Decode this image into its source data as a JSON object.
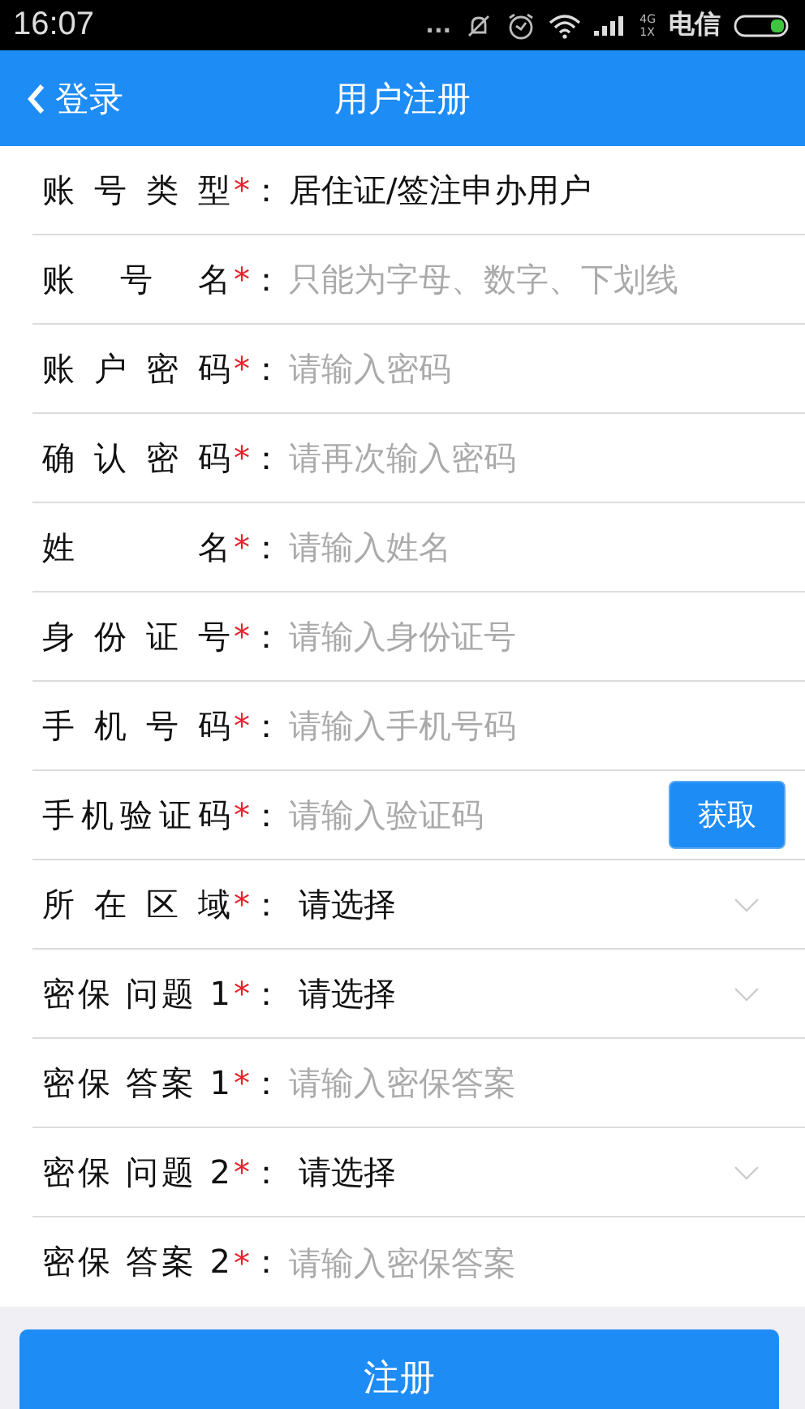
{
  "status_bar": {
    "time": "16:07",
    "dots": "...",
    "network": "4G",
    "network_sub": "1X",
    "carrier": "电信"
  },
  "header": {
    "back": "登录",
    "title": "用户注册"
  },
  "fields": [
    {
      "kind": "value",
      "label": "账 号 类 型",
      "asterisk": "*",
      "colon": "：",
      "value": "居住证/签注申办用户"
    },
    {
      "kind": "input",
      "label": "账 号 名",
      "asterisk": "*",
      "colon": "：",
      "placeholder": "只能为字母、数字、下划线"
    },
    {
      "kind": "input",
      "label": "账 户 密 码",
      "asterisk": "*",
      "colon": "：",
      "placeholder": "请输入密码"
    },
    {
      "kind": "input",
      "label": "确 认 密 码",
      "asterisk": "*",
      "colon": "：",
      "placeholder": "请再次输入密码"
    },
    {
      "kind": "input",
      "label": "姓 名",
      "asterisk": "*",
      "colon": "：",
      "placeholder": "请输入姓名"
    },
    {
      "kind": "input",
      "label": "身 份 证 号",
      "asterisk": "*",
      "colon": "：",
      "placeholder": "请输入身份证号"
    },
    {
      "kind": "input",
      "label": "手 机 号 码",
      "asterisk": "*",
      "colon": "：",
      "placeholder": "请输入手机号码"
    },
    {
      "kind": "code",
      "label": "手机验证码",
      "asterisk": "*",
      "colon": "：",
      "placeholder": "请输入验证码",
      "button": "获取"
    },
    {
      "kind": "select",
      "label": "所 在 区 域",
      "asterisk": "*",
      "colon": "：",
      "value": "请选择"
    },
    {
      "kind": "select",
      "label": "密保 问题 1",
      "asterisk": "*",
      "colon": "：",
      "value": "请选择"
    },
    {
      "kind": "input",
      "label": "密保 答案 1",
      "asterisk": "*",
      "colon": "：",
      "placeholder": "请输入密保答案"
    },
    {
      "kind": "select",
      "label": "密保 问题 2",
      "asterisk": "*",
      "colon": "：",
      "value": "请选择"
    },
    {
      "kind": "input",
      "label": "密保 答案 2",
      "asterisk": "*",
      "colon": "：",
      "placeholder": "请输入密保答案"
    }
  ],
  "submit": "注册"
}
